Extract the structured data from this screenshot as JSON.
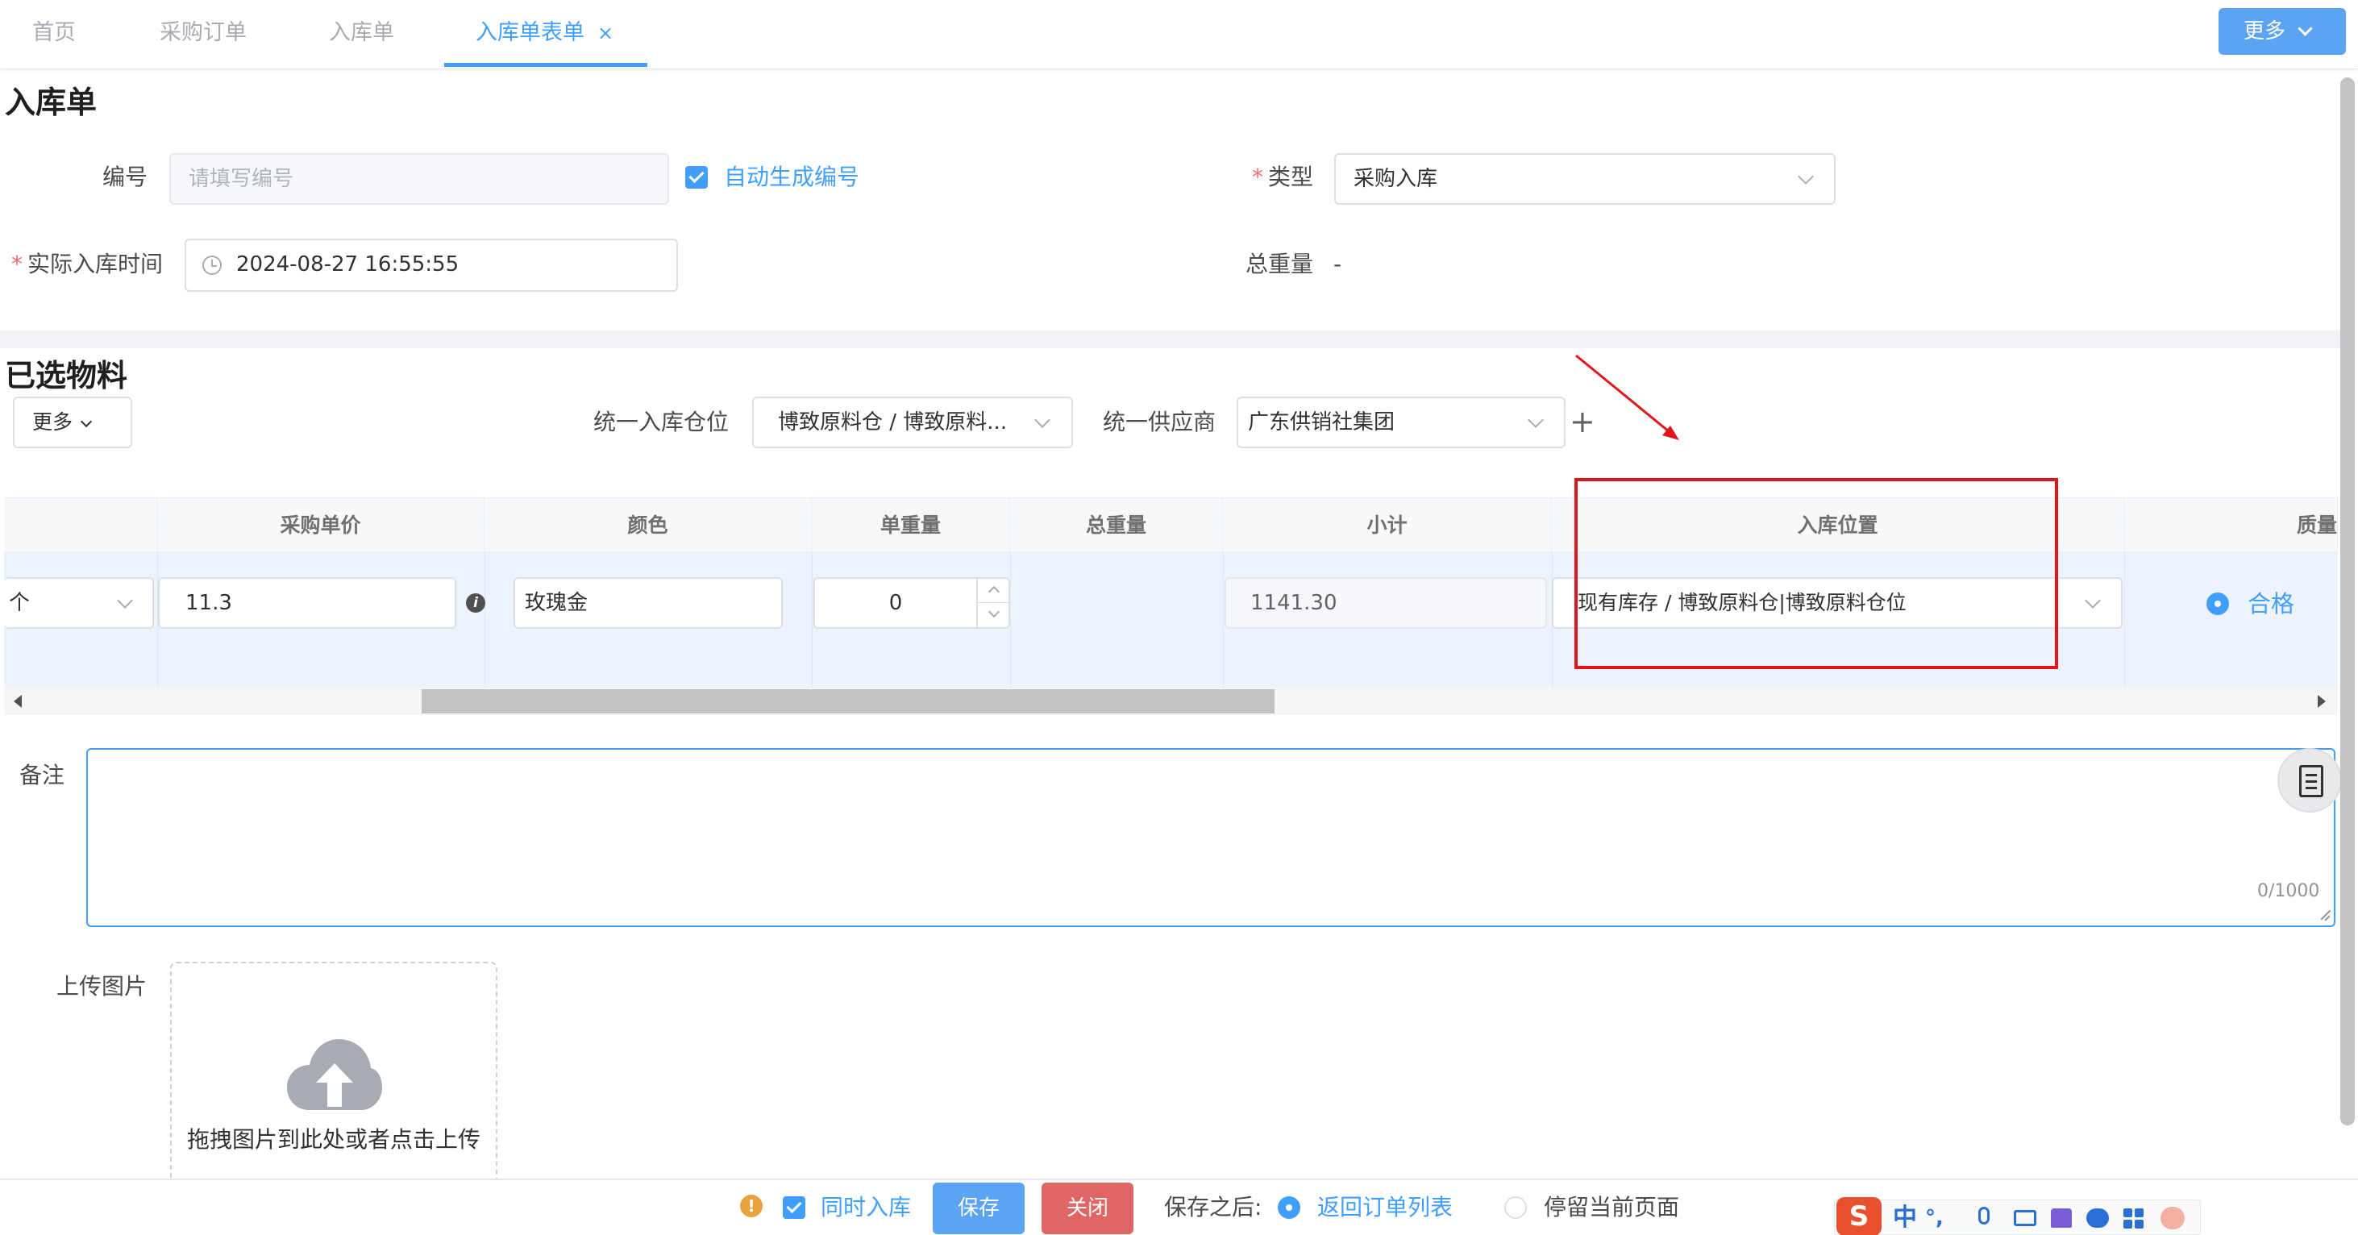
{
  "tabs": [
    {
      "label": "首页"
    },
    {
      "label": "采购订单"
    },
    {
      "label": "入库单"
    },
    {
      "label": "入库单表单",
      "close": "×"
    }
  ],
  "topbar": {
    "more_label": "更多"
  },
  "form": {
    "title": "入库单",
    "number": {
      "label": "编号",
      "placeholder": "请填写编号",
      "auto_label": "自动生成编号"
    },
    "type": {
      "label": "类型",
      "value": "采购入库"
    },
    "time": {
      "label": "实际入库时间",
      "value": "2024-08-27 16:55:55"
    },
    "total_weight": {
      "label": "总重量",
      "value": "-"
    }
  },
  "materials": {
    "title": "已选物料",
    "more_label": "更多",
    "warehouse": {
      "label": "统一入库仓位",
      "value": "博致原料仓 / 博致原料..."
    },
    "supplier": {
      "label": "统一供应商",
      "value": "广东供销社集团"
    },
    "add_icon": "+",
    "table": {
      "headers": [
        "采购单价",
        "颜色",
        "单重量",
        "总重量",
        "小计",
        "入库位置",
        "质量"
      ],
      "row": {
        "unit": "个",
        "price": "11.3",
        "color": "玫瑰金",
        "unit_weight": "0",
        "subtotal": "1141.30",
        "location": "现有库存 / 博致原料仓|博致原料仓位",
        "quality": "合格"
      }
    }
  },
  "remark": {
    "label": "备注",
    "counter": "0/1000"
  },
  "upload": {
    "label": "上传图片",
    "hint": "拖拽图片到此处或者点击上传"
  },
  "footer": {
    "also_stock_label": "同时入库",
    "save_label": "保存",
    "close_label": "关闭",
    "after_save_label": "保存之后:",
    "option_return": "返回订单列表",
    "option_stay": "停留当前页面"
  },
  "ime": {
    "lang": "中",
    "punct": "°,"
  },
  "colors": {
    "accent": "#409eff",
    "danger": "#e06666",
    "annotation": "#e0161b"
  }
}
